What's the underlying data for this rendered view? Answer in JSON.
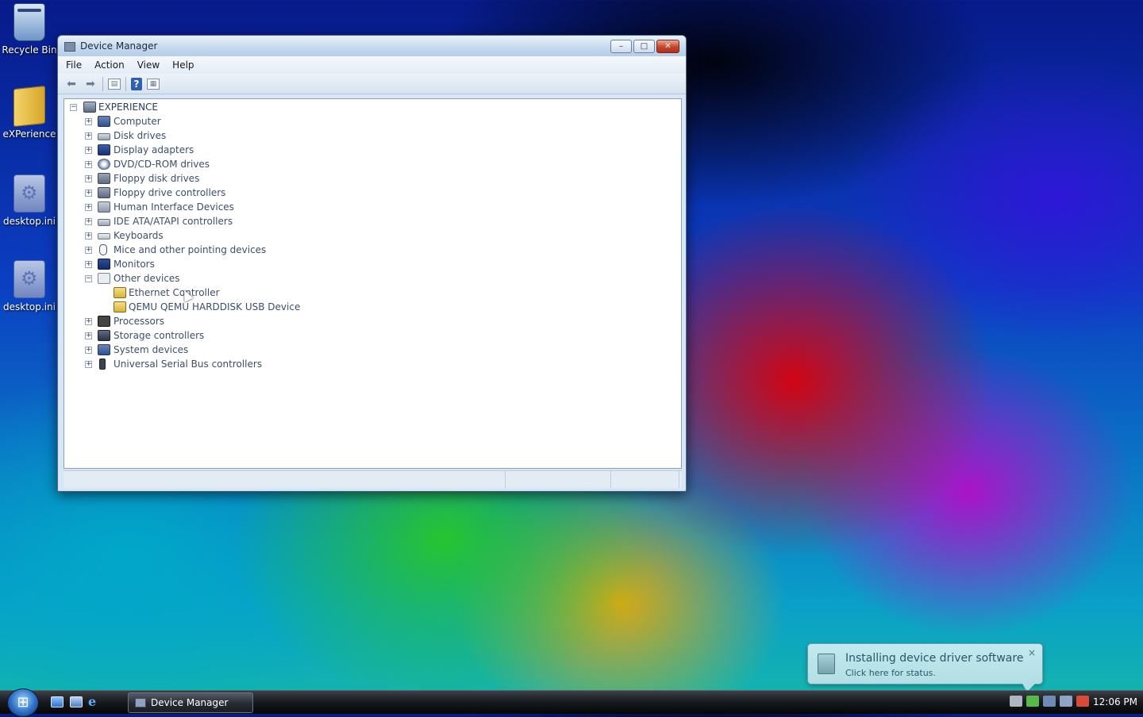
{
  "desktop": {
    "icons": [
      {
        "label": "Recycle Bin",
        "icon": "recycle-bin-icon"
      },
      {
        "label": "eXPerience",
        "icon": "folder-icon"
      },
      {
        "label": "desktop.ini",
        "icon": "settings-file-icon"
      },
      {
        "label": "desktop.ini",
        "icon": "settings-file-icon"
      }
    ]
  },
  "window": {
    "title": "Device Manager",
    "controls": {
      "minimize": "–",
      "maximize": "□",
      "close": "✕"
    },
    "menu": [
      "File",
      "Action",
      "View",
      "Help"
    ],
    "toolbar": [
      "back-icon",
      "forward-icon",
      "properties-icon",
      "help-icon",
      "scan-icon"
    ],
    "tree": {
      "root": "EXPERIENCE",
      "categories": [
        {
          "label": "Computer",
          "icon": "computer"
        },
        {
          "label": "Disk drives",
          "icon": "disk"
        },
        {
          "label": "Display adapters",
          "icon": "display"
        },
        {
          "label": "DVD/CD-ROM drives",
          "icon": "cd"
        },
        {
          "label": "Floppy disk drives",
          "icon": "floppy"
        },
        {
          "label": "Floppy drive controllers",
          "icon": "floppy"
        },
        {
          "label": "Human Interface Devices",
          "icon": "hid"
        },
        {
          "label": "IDE ATA/ATAPI controllers",
          "icon": "disk"
        },
        {
          "label": "Keyboards",
          "icon": "keyboard"
        },
        {
          "label": "Mice and other pointing devices",
          "icon": "mouse"
        },
        {
          "label": "Monitors",
          "icon": "monitor"
        },
        {
          "label": "Other devices",
          "icon": "other",
          "expanded": true,
          "children": [
            {
              "label": "Ethernet Controller",
              "icon": "warning"
            },
            {
              "label": "QEMU QEMU HARDDISK USB Device",
              "icon": "warning"
            }
          ]
        },
        {
          "label": "Processors",
          "icon": "cpu"
        },
        {
          "label": "Storage controllers",
          "icon": "storage"
        },
        {
          "label": "System devices",
          "icon": "system"
        },
        {
          "label": "Universal Serial Bus controllers",
          "icon": "usb"
        }
      ]
    }
  },
  "notification": {
    "title": "Installing device driver software",
    "subtitle": "Click here for status.",
    "close": "×"
  },
  "taskbar": {
    "start": "⊞",
    "task": "Device Manager",
    "clock": "12:06 PM"
  }
}
